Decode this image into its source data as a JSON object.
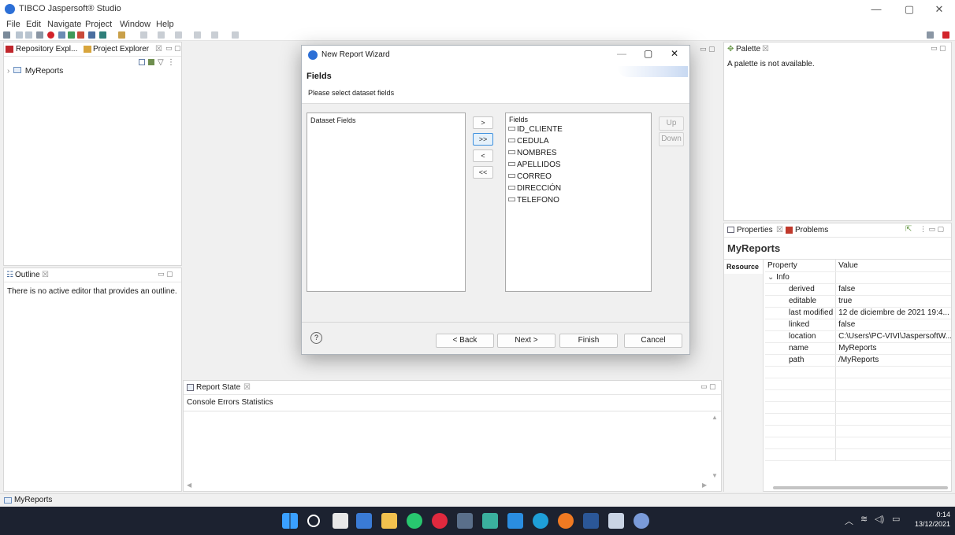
{
  "app": {
    "title": "TIBCO Jaspersoft® Studio"
  },
  "window_controls": {
    "minimize": "—",
    "maximize": "▢",
    "close": "✕"
  },
  "menu": [
    "File",
    "Edit",
    "Navigate",
    "Project",
    "Window",
    "Help"
  ],
  "left_top": {
    "tab1": "Repository Expl...",
    "tab2": "Project Explorer",
    "tab_close": "☒",
    "tree_item": "MyReports"
  },
  "outline": {
    "title": "Outline",
    "tab_close": "☒",
    "message": "There is no active editor that provides an outline."
  },
  "palette": {
    "title": "Palette",
    "tab_close": "☒",
    "message": "A palette is not available."
  },
  "properties": {
    "tab1": "Properties",
    "tab2": "Problems",
    "tab_close": "☒",
    "heading": "MyReports",
    "side_tab": "Resource",
    "col_property": "Property",
    "col_value": "Value",
    "group": "Info",
    "rows": [
      {
        "name": "derived",
        "value": "false"
      },
      {
        "name": "editable",
        "value": "true"
      },
      {
        "name": "last modified",
        "value": "12 de diciembre de 2021 19:4..."
      },
      {
        "name": "linked",
        "value": "false"
      },
      {
        "name": "location",
        "value": "C:\\Users\\PC-VIVI\\JaspersoftW..."
      },
      {
        "name": "name",
        "value": "MyReports"
      },
      {
        "name": "path",
        "value": "/MyReports"
      }
    ]
  },
  "report_state": {
    "title": "Report State",
    "tab_close": "☒",
    "tabs": [
      "Console",
      "Errors",
      "Statistics"
    ]
  },
  "status": {
    "text": "MyReports"
  },
  "dialog": {
    "title": "New Report Wizard",
    "page_title": "Fields",
    "description": "Please select dataset fields",
    "left_list_label": "Dataset Fields",
    "right_list_label": "Fields",
    "fields": [
      "ID_CLIENTE",
      "CEDULA",
      "NOMBRES",
      "APELLIDOS",
      "CORREO",
      "DIRECCIÓN",
      "TELEFONO"
    ],
    "move_buttons": [
      ">",
      ">>",
      "<",
      "<<"
    ],
    "up": "Up",
    "down": "Down",
    "help": "?",
    "back": "< Back",
    "next": "Next >",
    "finish": "Finish",
    "cancel": "Cancel"
  },
  "tray": {
    "time": "0:14",
    "date": "13/12/2021"
  }
}
